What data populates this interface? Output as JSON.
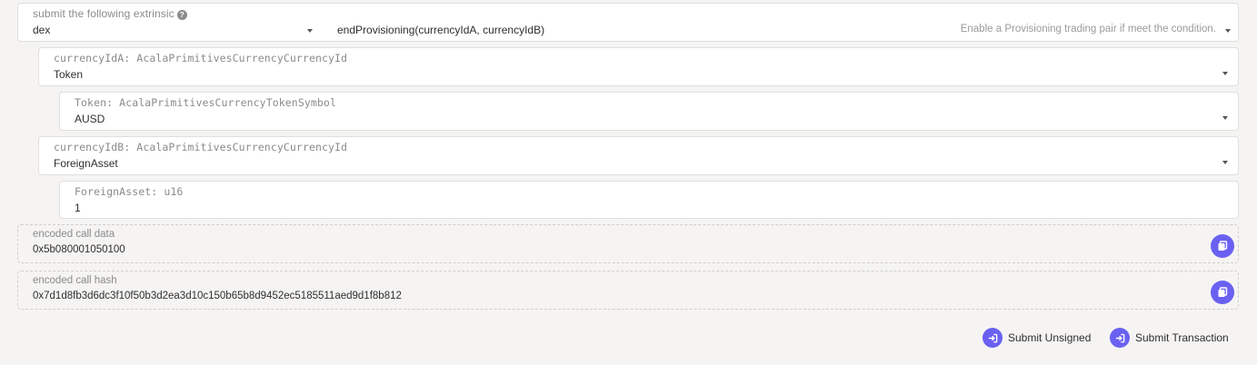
{
  "extrinsic": {
    "label": "submit the following extrinsic",
    "help_icon": "question-circle-icon",
    "section_value": "dex",
    "method_value": "endProvisioning(currencyIdA, currencyIdB)",
    "method_description": "Enable a Provisioning trading pair if meet the condition."
  },
  "params": {
    "currencyIdA": {
      "label": "currencyIdA: AcalaPrimitivesCurrencyCurrencyId",
      "value": "Token"
    },
    "token": {
      "label": "Token: AcalaPrimitivesCurrencyTokenSymbol",
      "value": "AUSD"
    },
    "currencyIdB": {
      "label": "currencyIdB: AcalaPrimitivesCurrencyCurrencyId",
      "value": "ForeignAsset"
    },
    "foreignAsset": {
      "label": "ForeignAsset: u16",
      "value": "1"
    }
  },
  "encoded_call_data": {
    "label": "encoded call data",
    "value": "0x5b080001050100",
    "copy_icon": "copy-icon"
  },
  "encoded_call_hash": {
    "label": "encoded call hash",
    "value": "0x7d1d8fb3d6dc3f10f50b3d2ea3d10c150b65b8d9452ec5185511aed9d1f8b812",
    "copy_icon": "copy-icon"
  },
  "actions": {
    "submit_unsigned": "Submit Unsigned",
    "submit_transaction": "Submit Transaction",
    "icon": "sign-in-icon"
  },
  "colors": {
    "accent": "#6a61f2",
    "background": "#f5f4f3"
  }
}
